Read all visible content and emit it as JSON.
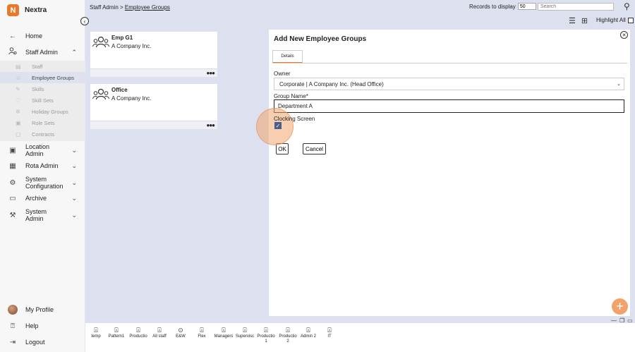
{
  "app": {
    "name": "Nextra",
    "logo": "N"
  },
  "sidebar": {
    "home": "Home",
    "staff_admin": "Staff Admin",
    "sub_items": [
      "Staff",
      "Employee Groups",
      "Skills",
      "Skill Sets",
      "Holiday Groups",
      "Role Sets",
      "Contracts"
    ],
    "location_admin": "Location Admin",
    "rota_admin": "Rota Admin",
    "system_configuration": "System Configuration",
    "archive": "Archive",
    "system_admin": "System Admin",
    "my_profile": "My Profile",
    "help": "Help",
    "logout": "Logout"
  },
  "topbar": {
    "breadcrumb_parent": "Staff Admin > ",
    "breadcrumb_current": "Employee Groups",
    "records_label": "Records to display",
    "records_value": "50",
    "search_placeholder": "Search",
    "highlight_all": "Highlight All"
  },
  "groups": [
    {
      "name": "Emp G1",
      "company": "A Company Inc."
    },
    {
      "name": "Office",
      "company": "A Company Inc."
    }
  ],
  "modal": {
    "title": "Add New Employee Groups",
    "tab": "Details",
    "owner_label": "Owner",
    "owner_value": "Corporate | A Company Inc. (Head Office)",
    "group_name_label": "Group Name*",
    "group_name_value": "Department A",
    "clocking_label": "Clocking Screen",
    "clocking_checked": true,
    "ok": "OK",
    "cancel": "Cancel"
  },
  "tray": [
    "temp",
    "Pattern1",
    "Productio",
    "All staff",
    "E&W",
    "Flex",
    "Managers",
    "Supervisc",
    "Productio 1",
    "Productio 2",
    "Admin 2",
    "IT"
  ],
  "colors": {
    "accent": "#e8792a",
    "content_bg": "#dde0ee",
    "checkbox": "#4a5e8e"
  }
}
